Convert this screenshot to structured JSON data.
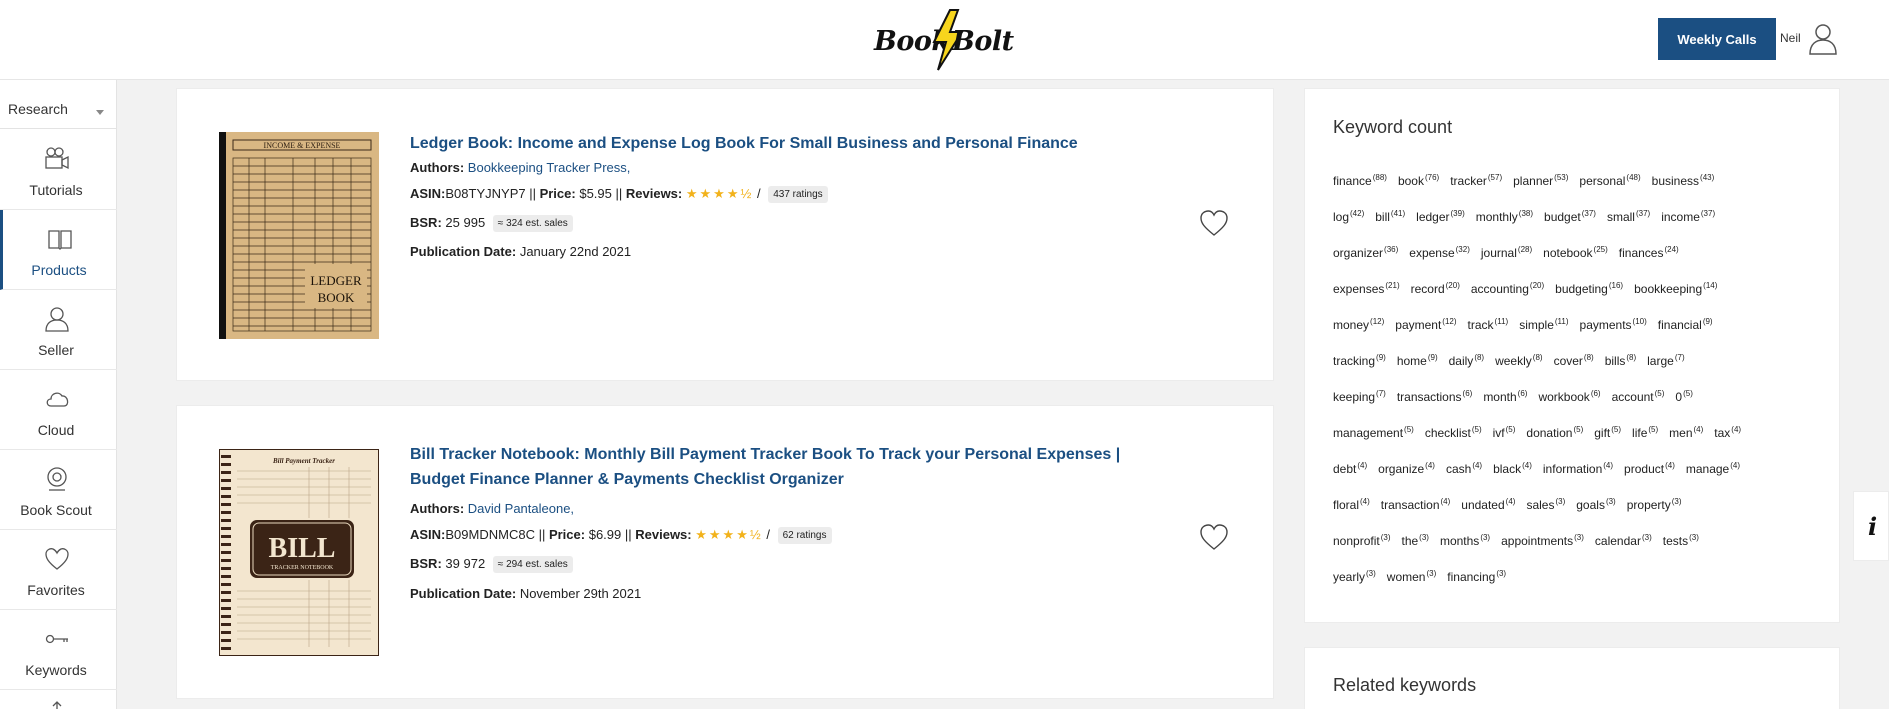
{
  "header": {
    "logo_word1": "Book",
    "logo_word2": "Bolt",
    "weekly_calls_label": "Weekly Calls",
    "user_name": "Neil"
  },
  "sidebar": {
    "select_value": "Research",
    "items": [
      {
        "label": "Tutorials",
        "icon": "video-camera-icon"
      },
      {
        "label": "Products",
        "icon": "book-icon"
      },
      {
        "label": "Seller",
        "icon": "user-icon"
      },
      {
        "label": "Cloud",
        "icon": "cloud-icon"
      },
      {
        "label": "Book Scout",
        "icon": "scout-icon"
      },
      {
        "label": "Favorites",
        "icon": "heart-icon"
      },
      {
        "label": "Keywords",
        "icon": "key-icon"
      }
    ]
  },
  "books": [
    {
      "title": "Ledger Book: Income and Expense Log Book For Small Business and Personal Finance",
      "authors_label": "Authors:",
      "author": "Bookkeeping Tracker Press,",
      "asin_label": "ASIN:",
      "asin": "B08TYJNYP7",
      "sep1": " || ",
      "price_label": "Price:",
      "price": "$5.95",
      "sep2": " || ",
      "reviews_label": "Reviews:",
      "stars": "★★★★½",
      "slash": " /",
      "ratings": "437 ratings",
      "bsr_label": "BSR:",
      "bsr": "25 995",
      "est_sales": "≈ 324 est. sales",
      "pubdate_label": "Publication Date:",
      "pubdate": "January 22nd 2021",
      "cover_top": "INCOME & EXPENSE",
      "cover_main1": "LEDGER",
      "cover_main2": "BOOK"
    },
    {
      "title_line1": "Bill Tracker Notebook: Monthly Bill Payment Tracker Book To Track your Personal Expenses |",
      "title_line2": "Budget Finance Planner & Payments Checklist Organizer",
      "authors_label": "Authors:",
      "author": "David Pantaleone,",
      "asin_label": "ASIN:",
      "asin": "B09MDNMC8C",
      "sep1": " || ",
      "price_label": "Price:",
      "price": "$6.99",
      "sep2": " || ",
      "reviews_label": "Reviews:",
      "stars": "★★★★½",
      "slash": " /",
      "ratings": "62 ratings",
      "bsr_label": "BSR:",
      "bsr": "39 972",
      "est_sales": "≈ 294 est. sales",
      "pubdate_label": "Publication Date:",
      "pubdate": "November 29th 2021",
      "cover_top": "Bill Payment Tracker",
      "cover_main": "BILL",
      "cover_sub": "TRACKER NOTEBOOK"
    }
  ],
  "keyword_panel": {
    "title": "Keyword count",
    "keywords": [
      {
        "word": "finance",
        "count": "(88)"
      },
      {
        "word": "book",
        "count": "(76)"
      },
      {
        "word": "tracker",
        "count": "(57)"
      },
      {
        "word": "planner",
        "count": "(53)"
      },
      {
        "word": "personal",
        "count": "(48)"
      },
      {
        "word": "business",
        "count": "(43)"
      },
      {
        "word": "log",
        "count": "(42)"
      },
      {
        "word": "bill",
        "count": "(41)"
      },
      {
        "word": "ledger",
        "count": "(39)"
      },
      {
        "word": "monthly",
        "count": "(38)"
      },
      {
        "word": "budget",
        "count": "(37)"
      },
      {
        "word": "small",
        "count": "(37)"
      },
      {
        "word": "income",
        "count": "(37)"
      },
      {
        "word": "organizer",
        "count": "(36)"
      },
      {
        "word": "expense",
        "count": "(32)"
      },
      {
        "word": "journal",
        "count": "(28)"
      },
      {
        "word": "notebook",
        "count": "(25)"
      },
      {
        "word": "finances",
        "count": "(24)"
      },
      {
        "word": "expenses",
        "count": "(21)"
      },
      {
        "word": "record",
        "count": "(20)"
      },
      {
        "word": "accounting",
        "count": "(20)"
      },
      {
        "word": "budgeting",
        "count": "(16)"
      },
      {
        "word": "bookkeeping",
        "count": "(14)"
      },
      {
        "word": "money",
        "count": "(12)"
      },
      {
        "word": "payment",
        "count": "(12)"
      },
      {
        "word": "track",
        "count": "(11)"
      },
      {
        "word": "simple",
        "count": "(11)"
      },
      {
        "word": "payments",
        "count": "(10)"
      },
      {
        "word": "financial",
        "count": "(9)"
      },
      {
        "word": "tracking",
        "count": "(9)"
      },
      {
        "word": "home",
        "count": "(9)"
      },
      {
        "word": "daily",
        "count": "(8)"
      },
      {
        "word": "weekly",
        "count": "(8)"
      },
      {
        "word": "cover",
        "count": "(8)"
      },
      {
        "word": "bills",
        "count": "(8)"
      },
      {
        "word": "large",
        "count": "(7)"
      },
      {
        "word": "keeping",
        "count": "(7)"
      },
      {
        "word": "transactions",
        "count": "(6)"
      },
      {
        "word": "month",
        "count": "(6)"
      },
      {
        "word": "workbook",
        "count": "(6)"
      },
      {
        "word": "account",
        "count": "(5)"
      },
      {
        "word": "0",
        "count": "(5)"
      },
      {
        "word": "management",
        "count": "(5)"
      },
      {
        "word": "checklist",
        "count": "(5)"
      },
      {
        "word": "ivf",
        "count": "(5)"
      },
      {
        "word": "donation",
        "count": "(5)"
      },
      {
        "word": "gift",
        "count": "(5)"
      },
      {
        "word": "life",
        "count": "(5)"
      },
      {
        "word": "men",
        "count": "(4)"
      },
      {
        "word": "tax",
        "count": "(4)"
      },
      {
        "word": "debt",
        "count": "(4)"
      },
      {
        "word": "organize",
        "count": "(4)"
      },
      {
        "word": "cash",
        "count": "(4)"
      },
      {
        "word": "black",
        "count": "(4)"
      },
      {
        "word": "information",
        "count": "(4)"
      },
      {
        "word": "product",
        "count": "(4)"
      },
      {
        "word": "manage",
        "count": "(4)"
      },
      {
        "word": "floral",
        "count": "(4)"
      },
      {
        "word": "transaction",
        "count": "(4)"
      },
      {
        "word": "undated",
        "count": "(4)"
      },
      {
        "word": "sales",
        "count": "(3)"
      },
      {
        "word": "goals",
        "count": "(3)"
      },
      {
        "word": "property",
        "count": "(3)"
      },
      {
        "word": "nonprofit",
        "count": "(3)"
      },
      {
        "word": "the",
        "count": "(3)"
      },
      {
        "word": "months",
        "count": "(3)"
      },
      {
        "word": "appointments",
        "count": "(3)"
      },
      {
        "word": "calendar",
        "count": "(3)"
      },
      {
        "word": "tests",
        "count": "(3)"
      },
      {
        "word": "yearly",
        "count": "(3)"
      },
      {
        "word": "women",
        "count": "(3)"
      },
      {
        "word": "financing",
        "count": "(3)"
      }
    ],
    "row_breaks": [
      6,
      13,
      18,
      23,
      29,
      36,
      42,
      50,
      57,
      63,
      69,
      72
    ]
  },
  "related_panel": {
    "title": "Related keywords"
  },
  "info_tab": {
    "glyph": "i"
  },
  "colors": {
    "accent": "#1b4f82",
    "star": "#f2b21b"
  }
}
